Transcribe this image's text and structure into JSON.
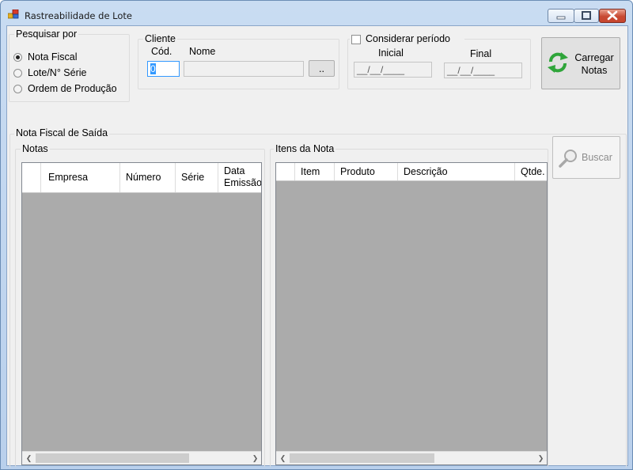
{
  "window": {
    "title": "Rastreabilidade de Lote"
  },
  "pesquisar": {
    "legend": "Pesquisar por",
    "options": [
      {
        "label": "Nota Fiscal",
        "selected": true
      },
      {
        "label": "Lote/N° Série",
        "selected": false
      },
      {
        "label": "Ordem de Produção",
        "selected": false
      }
    ]
  },
  "cliente": {
    "legend": "Cliente",
    "cod_label": "Cód.",
    "nome_label": "Nome",
    "cod_value": "0",
    "nome_value": "",
    "browse_label": ".."
  },
  "periodo": {
    "checkbox_label": "Considerar período",
    "checked": false,
    "inicial_label": "Inicial",
    "final_label": "Final",
    "inicial_value": "__/__/____",
    "final_value": "__/__/____"
  },
  "carregar_button": {
    "line1": "Carregar",
    "line2": "Notas"
  },
  "buscar_button": {
    "label": "Buscar"
  },
  "nota_saida": {
    "legend": "Nota Fiscal de Saída"
  },
  "notas": {
    "legend": "Notas",
    "columns": [
      "Empresa",
      "Número",
      "Série",
      "Data Emissão"
    ]
  },
  "itens": {
    "legend": "Itens da Nota",
    "columns": [
      "Item",
      "Produto",
      "Descrição",
      "Qtde."
    ]
  },
  "colors": {
    "accent": "#3399ff",
    "grid_bg": "#ababab",
    "window_frame": "#b9d0ec"
  }
}
